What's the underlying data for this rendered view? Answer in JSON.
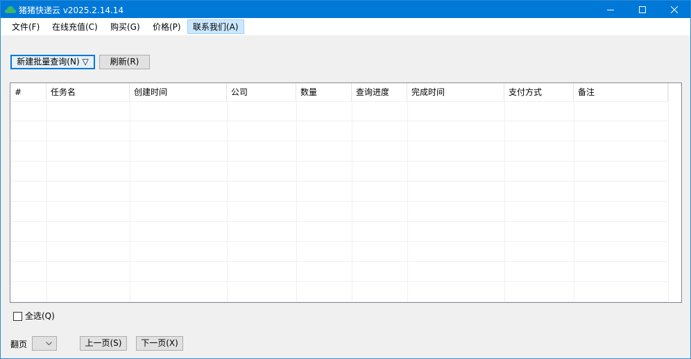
{
  "window": {
    "title": "猪猪快递云 v2025.2.14.14",
    "accent": "#0078d7"
  },
  "titlebar_icons": {
    "app": "cloud-icon",
    "minimize": "minimize-icon",
    "maximize": "maximize-icon",
    "close": "close-icon"
  },
  "menu": {
    "items": [
      {
        "label": "文件(F)"
      },
      {
        "label": "在线充值(C)"
      },
      {
        "label": "购买(G)"
      },
      {
        "label": "价格(P)"
      },
      {
        "label": "联系我们(A)"
      }
    ]
  },
  "toolbar": {
    "new_batch_label": "新建批量查询(N) ▽",
    "refresh_label": "刷新(R)"
  },
  "table": {
    "columns": [
      {
        "label": "#"
      },
      {
        "label": "任务名"
      },
      {
        "label": "创建时间"
      },
      {
        "label": "公司"
      },
      {
        "label": "数量"
      },
      {
        "label": "查询进度"
      },
      {
        "label": "完成时间"
      },
      {
        "label": "支付方式"
      },
      {
        "label": "备注"
      }
    ],
    "rows": []
  },
  "footer": {
    "select_all_label": "全选(Q)",
    "page_label": "翻页",
    "page_select_value": "",
    "prev_label": "上一页(S)",
    "next_label": "下一页(X)"
  }
}
